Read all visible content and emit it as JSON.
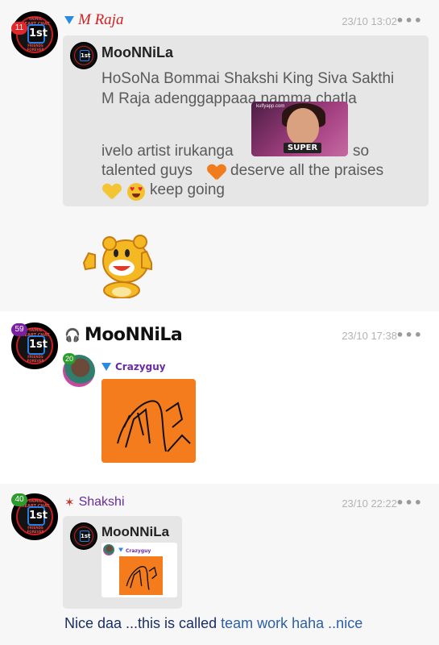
{
  "posts": [
    {
      "badge": "11",
      "badge_color": "#e2262a",
      "author": "M Raja",
      "time": "23/10 13:02",
      "more": "•••",
      "quote": {
        "author": "MooNNiLa",
        "line1": "HoSoNa Bommai Shakshi King Siva Sakthi",
        "line2": "M Raja adenggappaaa namma chatla",
        "line3": "ivelo artist irukanga",
        "line3_end": "so",
        "line4": "talented guys",
        "line4_end": "deserve all the praises",
        "line5_end": "keep going",
        "gif_watermark": "kulfyapp.com",
        "gif_caption": "SUPER"
      }
    },
    {
      "badge": "59",
      "badge_color": "#7a1fa3",
      "author": "MooNNiLa",
      "time": "23/10 17:38",
      "more": "•••",
      "reply_badge": "20",
      "reply_author": "Crazyguy"
    },
    {
      "badge": "40",
      "badge_color": "#2e9b2e",
      "author": "Shakshi",
      "time": "23/10 22:22",
      "more": "•••",
      "quote_author": "MooNNiLa",
      "quote_inner_author": "Crazyguy",
      "message_part1": "Nice daa ...this is called",
      "message_part2": "team work haha ..nice"
    }
  ],
  "avatar_text": {
    "top": "TAMIL HEART CHAT",
    "center": "1st",
    "bottom": "FRIENDS FOREVER"
  },
  "colors": {
    "author_red": "#d42020",
    "shakshi_purple": "#6a2aa0",
    "link_blue": "#2b5fa8",
    "drawing_orange": "#f57c1c"
  }
}
